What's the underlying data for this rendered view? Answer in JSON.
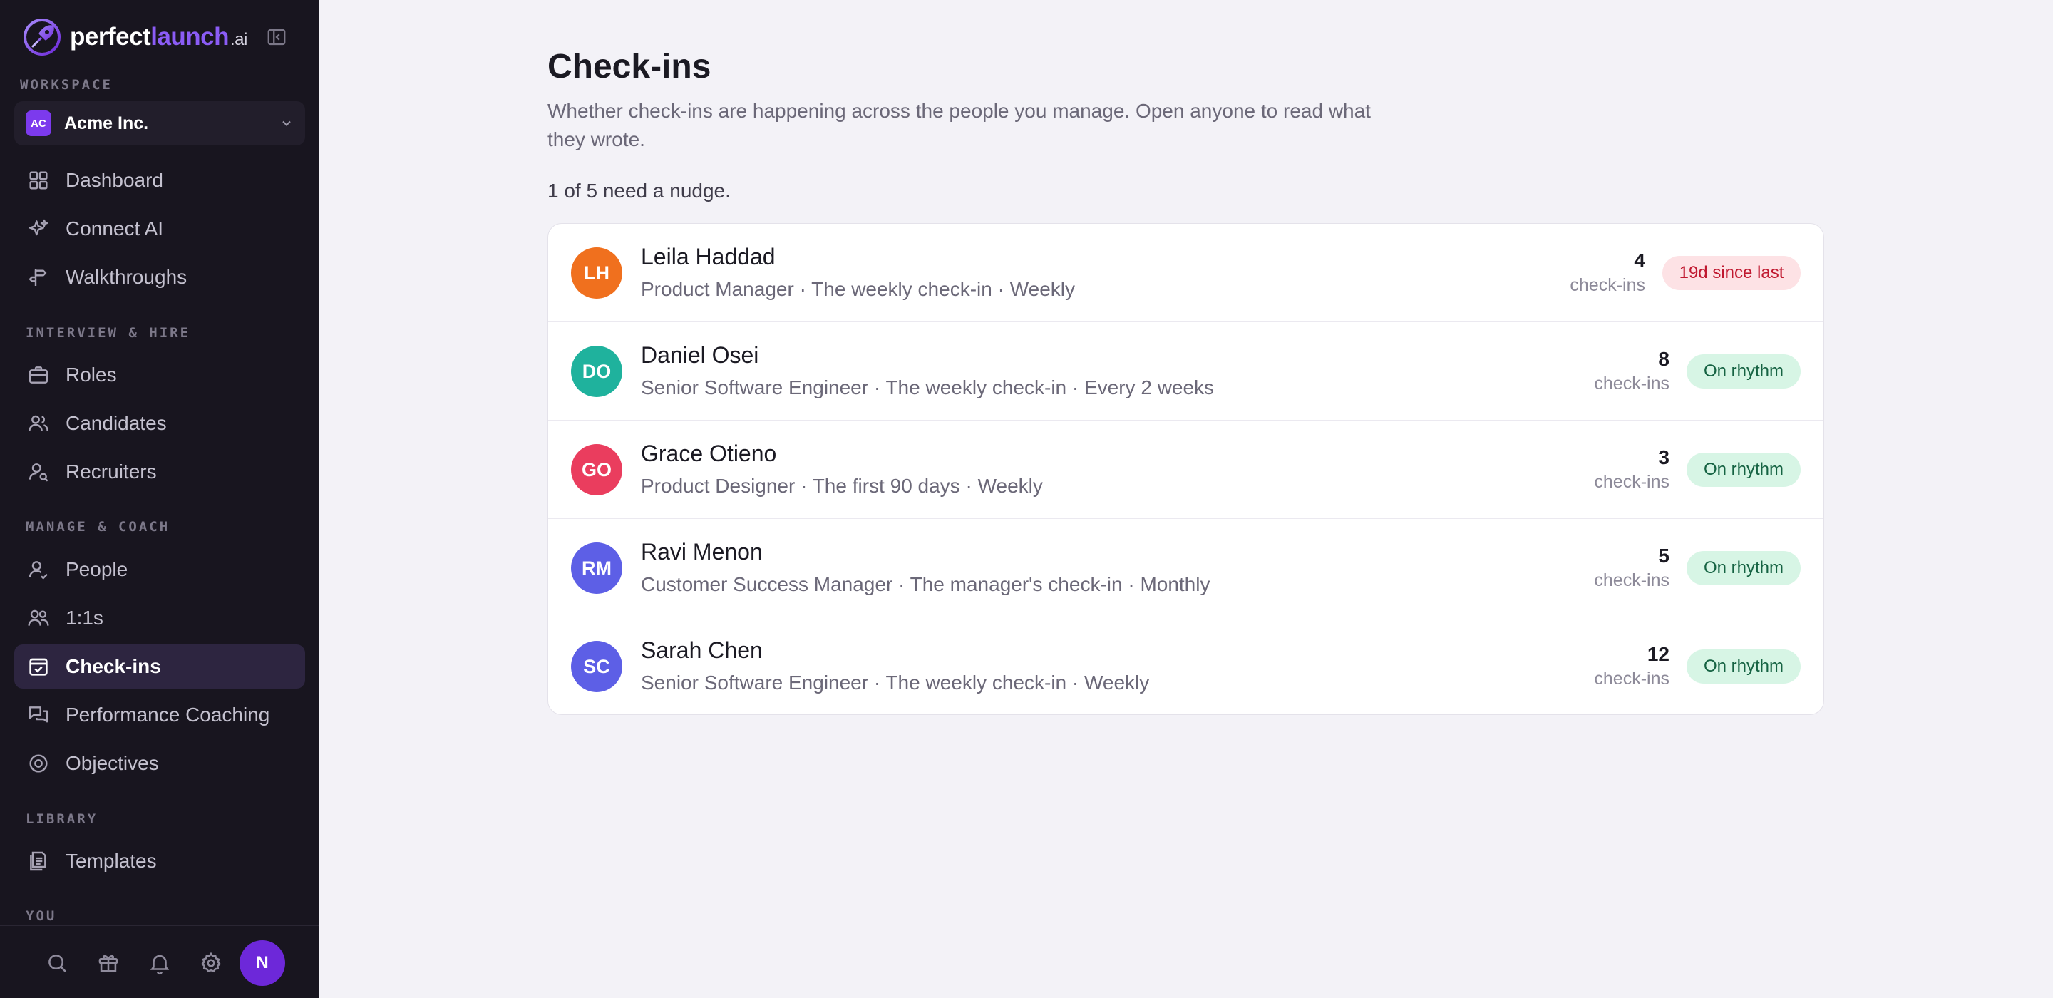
{
  "brand": {
    "part1": "perfect",
    "part2": "launch",
    "part3": ".ai"
  },
  "sidebar": {
    "workspace_label": "WORKSPACE",
    "workspace": {
      "initials": "AC",
      "name": "Acme Inc."
    },
    "sections": {
      "interview": "INTERVIEW & HIRE",
      "manage": "MANAGE & COACH",
      "library": "LIBRARY",
      "you": "YOU"
    },
    "items": [
      {
        "label": "Dashboard",
        "icon": "grid-icon"
      },
      {
        "label": "Connect AI",
        "icon": "sparkle-icon"
      },
      {
        "label": "Walkthroughs",
        "icon": "signpost-icon"
      },
      {
        "label": "Roles",
        "icon": "briefcase-icon"
      },
      {
        "label": "Candidates",
        "icon": "users-icon"
      },
      {
        "label": "Recruiters",
        "icon": "user-search-icon"
      },
      {
        "label": "People",
        "icon": "user-icon"
      },
      {
        "label": "1:1s",
        "icon": "two-users-icon"
      },
      {
        "label": "Check-ins",
        "icon": "calendar-check-icon",
        "active": true
      },
      {
        "label": "Performance Coaching",
        "icon": "chat-bubbles-icon"
      },
      {
        "label": "Objectives",
        "icon": "target-icon"
      },
      {
        "label": "Templates",
        "icon": "document-stack-icon"
      }
    ],
    "footer": {
      "icons": [
        "search-icon",
        "gift-icon",
        "bell-icon",
        "gear-icon"
      ],
      "avatar_initial": "N"
    }
  },
  "main": {
    "title": "Check-ins",
    "subtitle": "Whether check-ins are happening across the people you manage. Open anyone to read what they wrote.",
    "summary": "1 of 5 need a nudge.",
    "count_label": "check-ins",
    "people": [
      {
        "initials": "LH",
        "name": "Leila Haddad",
        "meta": "Product Manager · The weekly check-in · Weekly",
        "count": "4",
        "status": "19d since last",
        "status_type": "warn",
        "avatar_color": "#f0701e"
      },
      {
        "initials": "DO",
        "name": "Daniel Osei",
        "meta": "Senior Software Engineer · The weekly check-in · Every 2 weeks",
        "count": "8",
        "status": "On rhythm",
        "status_type": "ok",
        "avatar_color": "#1fb29d"
      },
      {
        "initials": "GO",
        "name": "Grace Otieno",
        "meta": "Product Designer · The first 90 days · Weekly",
        "count": "3",
        "status": "On rhythm",
        "status_type": "ok",
        "avatar_color": "#ea3d5e"
      },
      {
        "initials": "RM",
        "name": "Ravi Menon",
        "meta": "Customer Success Manager · The manager's check-in · Monthly",
        "count": "5",
        "status": "On rhythm",
        "status_type": "ok",
        "avatar_color": "#5d5fe6"
      },
      {
        "initials": "SC",
        "name": "Sarah Chen",
        "meta": "Senior Software Engineer · The weekly check-in · Weekly",
        "count": "12",
        "status": "On rhythm",
        "status_type": "ok",
        "avatar_color": "#5d5fe6"
      }
    ]
  }
}
